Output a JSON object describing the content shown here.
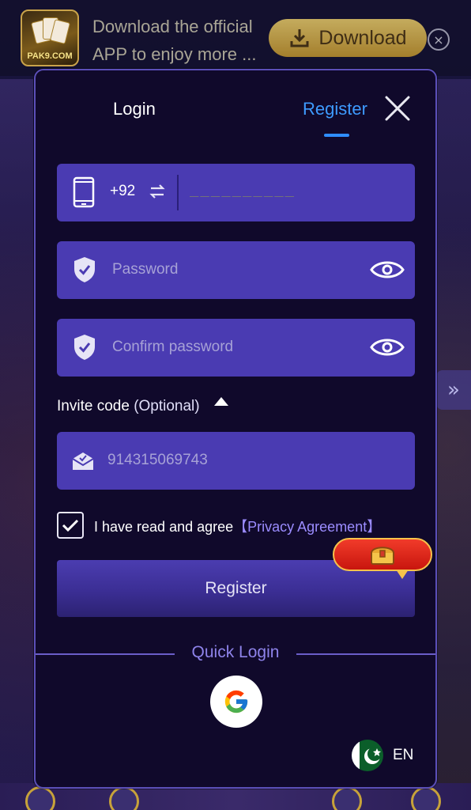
{
  "banner": {
    "logo_text": "PAK9.COM",
    "line1": "Download the official",
    "line2": "APP to enjoy more ...",
    "download_label": "Download",
    "close_symbol": "×"
  },
  "modal": {
    "tabs": {
      "login": "Login",
      "register": "Register"
    },
    "phone": {
      "country_code": "+92",
      "placeholder": "__________"
    },
    "password": {
      "placeholder": "Password"
    },
    "confirm_password": {
      "placeholder": "Confirm password"
    },
    "invite": {
      "label": "Invite code",
      "optional": "(Optional)",
      "value": "914315069743"
    },
    "agreement": {
      "text": "I have read and agree",
      "link": "【Privacy Agreement】",
      "checked": true
    },
    "register_button": "Register",
    "quick_login": "Quick Login",
    "language": "EN"
  },
  "colors": {
    "accent": "#3e9bff",
    "field_bg": "#4a3bb2",
    "modal_bg": "#10092b",
    "link": "#9b8cff"
  },
  "icons": [
    "phone-icon",
    "swap-icon",
    "shield-check-icon",
    "eye-icon",
    "caret-up-icon",
    "mail-icon",
    "checkmark-icon",
    "gift-chest-icon",
    "google-icon",
    "pakistan-flag-icon",
    "close-icon",
    "download-icon"
  ]
}
